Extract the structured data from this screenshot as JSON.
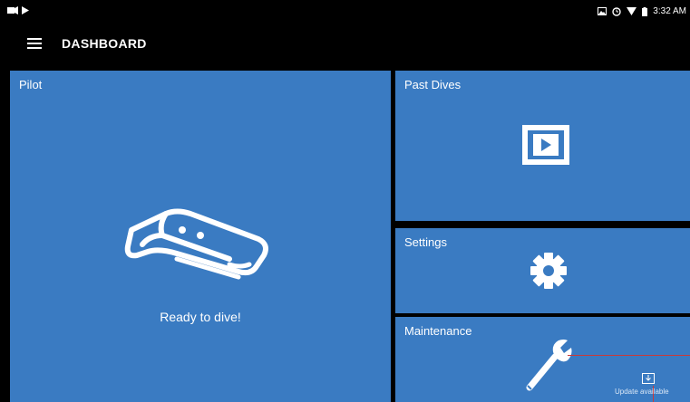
{
  "status_bar": {
    "time": "3:32 AM",
    "icons": [
      "media-icon",
      "play-store-icon",
      "image-icon",
      "alarm-icon",
      "wifi-icon",
      "battery-icon"
    ]
  },
  "app_bar": {
    "title": "DASHBOARD",
    "menu_icon": "hamburger-menu-icon"
  },
  "tiles": {
    "pilot": {
      "label": "Pilot",
      "status": "Ready to dive!",
      "icon": "rov-drone-icon"
    },
    "past_dives": {
      "label": "Past Dives",
      "icon": "video-film-icon"
    },
    "settings": {
      "label": "Settings",
      "icon": "gear-icon"
    },
    "maintenance": {
      "label": "Maintenance",
      "icon": "wrench-icon",
      "update_text": "Update available",
      "update_icon": "download-icon"
    }
  },
  "colors": {
    "tile_blue": "#3a7bc2",
    "background": "#000000",
    "annotation_red": "#c93a3a"
  }
}
